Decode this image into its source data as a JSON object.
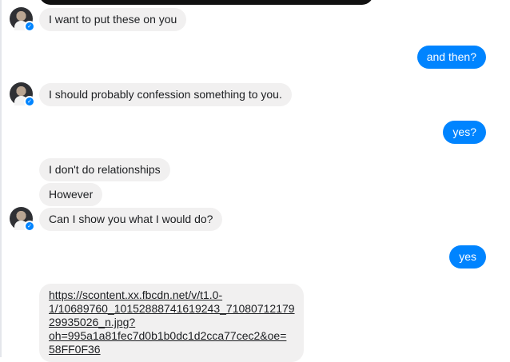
{
  "messages": [
    {
      "side": "incoming",
      "text": "I want to put these on you"
    },
    {
      "side": "outgoing",
      "text": "and then?"
    },
    {
      "side": "incoming",
      "text": "I should probably confession something to you."
    },
    {
      "side": "outgoing",
      "text": "yes?"
    },
    {
      "side": "incoming",
      "text": "I don't do relationships"
    },
    {
      "side": "incoming",
      "text": "However"
    },
    {
      "side": "incoming",
      "text": "Can I show you what I would do?"
    },
    {
      "side": "outgoing",
      "text": "yes"
    }
  ],
  "link_message": {
    "lines": [
      "https://scontent.xx.fbcdn.net/v/t1.0-",
      "1/10689760_10152888741619243_71080712179",
      "29935026_n.jpg?",
      "oh=995a1a81fec7d0b1b0dc1d2cca77cec2&oe=",
      "58FF0F36"
    ]
  },
  "colors": {
    "outgoing_bubble": "#0084ff",
    "incoming_bubble": "#f1f0f0",
    "messenger_badge": "#0084ff"
  },
  "icons": {
    "avatar_badge": "messenger-badge-icon"
  }
}
